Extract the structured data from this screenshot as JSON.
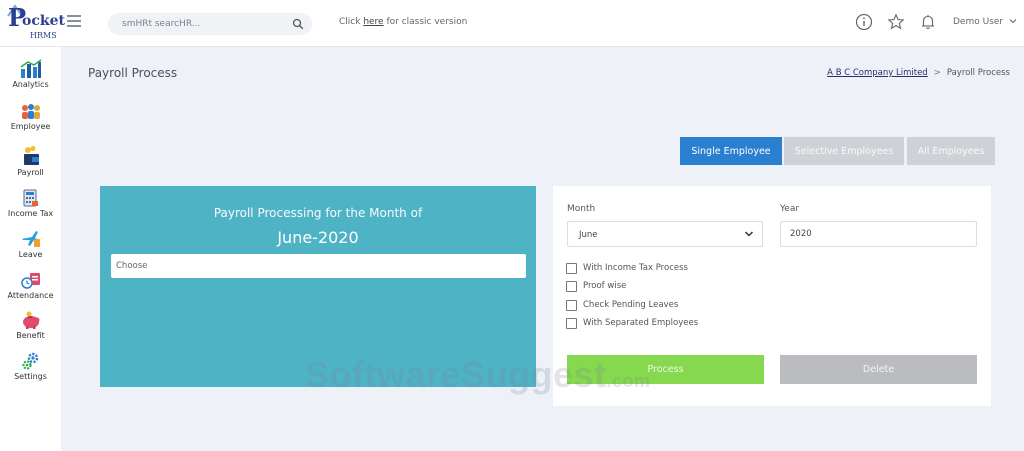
{
  "brand": {
    "logo_p": "P",
    "logo_ocket": "ocket",
    "logo_hrms": "HRMS"
  },
  "header": {
    "search_placeholder": "smHRt searcHR...",
    "classic_prefix": "Click ",
    "classic_link": "here",
    "classic_suffix": " for classic version",
    "user_name": "Demo User"
  },
  "sidebar": {
    "items": [
      {
        "label": "Analytics",
        "icon": "bar-chart-icon"
      },
      {
        "label": "Employee",
        "icon": "people-icon"
      },
      {
        "label": "Payroll",
        "icon": "wallet-icon"
      },
      {
        "label": "Income Tax",
        "icon": "calculator-icon"
      },
      {
        "label": "Leave",
        "icon": "plane-icon"
      },
      {
        "label": "Attendance",
        "icon": "clock-icon"
      },
      {
        "label": "Benefit",
        "icon": "piggy-bank-icon"
      },
      {
        "label": "Settings",
        "icon": "gear-icon"
      }
    ]
  },
  "page": {
    "title": "Payroll Process",
    "breadcrumb_company": "A B C Company Limited",
    "breadcrumb_sep": ">",
    "breadcrumb_current": "Payroll Process"
  },
  "tabs": {
    "single": "Single Employee",
    "selective": "Selective Employees",
    "all": "All Employees"
  },
  "processing_card": {
    "heading": "Payroll Processing for the Month of",
    "month_year": "June-2020",
    "choose_placeholder": "Choose"
  },
  "form": {
    "month_label": "Month",
    "month_value": "June",
    "year_label": "Year",
    "year_value": "2020",
    "options": [
      "With Income Tax Process",
      "Proof wise",
      "Check Pending Leaves",
      "With Separated Employees"
    ],
    "process_label": "Process",
    "delete_label": "Delete"
  },
  "watermark": {
    "main": "SoftwareSuggest",
    "suffix": ".com"
  },
  "colors": {
    "accent_blue": "#2a7fcf",
    "teal": "#4fb3c6",
    "process_green": "#86d84f",
    "disabled_gray": "#cfd1d6"
  }
}
